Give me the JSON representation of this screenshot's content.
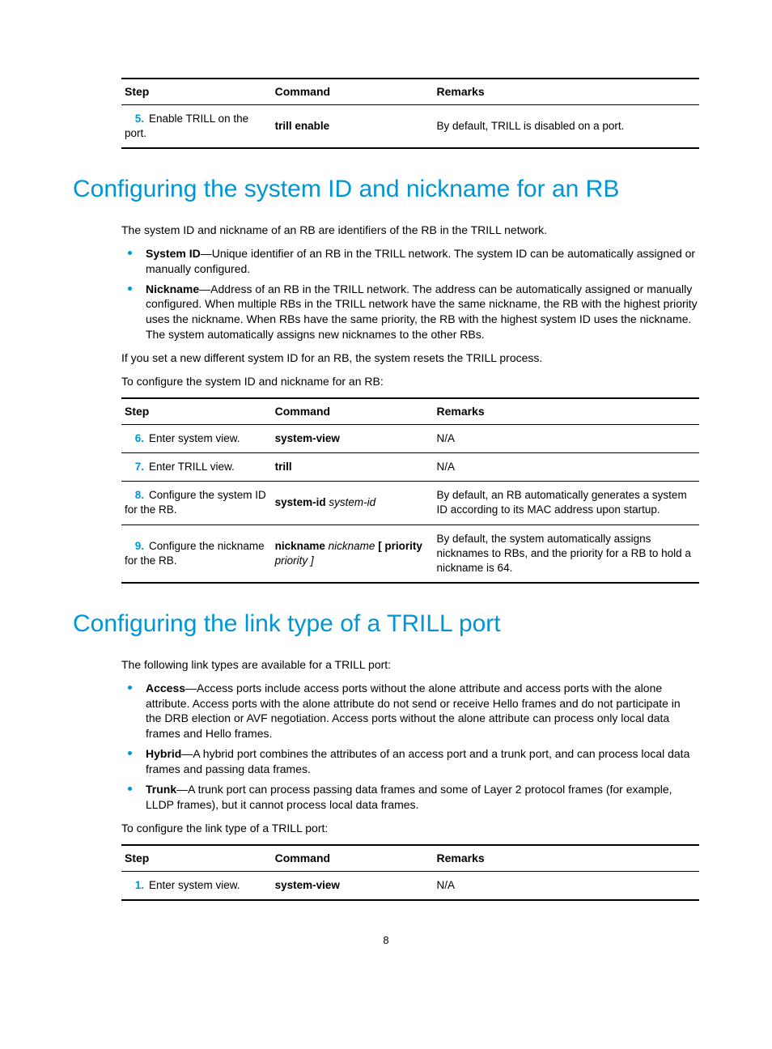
{
  "table1": {
    "headers": {
      "step": "Step",
      "command": "Command",
      "remarks": "Remarks"
    },
    "rows": [
      {
        "n": "5.",
        "step": "Enable TRILL on the port.",
        "cmd_bold": "trill enable",
        "cmd_italic": "",
        "remarks": "By default, TRILL is disabled on a port."
      }
    ]
  },
  "heading1": "Configuring the system ID and nickname for an RB",
  "h1_intro": "The system ID and nickname of an RB are identifiers of the RB in the TRILL network.",
  "h1_bullets": [
    {
      "term": "System ID",
      "text": "—Unique identifier of an RB in the TRILL network. The system ID can be automatically assigned or manually configured."
    },
    {
      "term": "Nickname",
      "text": "—Address of an RB in the TRILL network. The address can be automatically assigned or manually configured. When multiple RBs in the TRILL network have the same nickname, the RB with the highest priority uses the nickname. When RBs have the same priority, the RB with the highest system ID uses the nickname. The system automatically assigns new nicknames to the other RBs."
    }
  ],
  "h1_p2": "If you set a new different system ID for an RB, the system resets the TRILL process.",
  "h1_p3": "To configure the system ID and nickname for an RB:",
  "table2": {
    "headers": {
      "step": "Step",
      "command": "Command",
      "remarks": "Remarks"
    },
    "rows": [
      {
        "n": "6.",
        "step": "Enter system view.",
        "cmd_bold": "system-view",
        "cmd_italic": "",
        "cmd_bold2": "",
        "cmd_italic2": "",
        "remarks": "N/A"
      },
      {
        "n": "7.",
        "step": "Enter TRILL view.",
        "cmd_bold": "trill",
        "cmd_italic": "",
        "cmd_bold2": "",
        "cmd_italic2": "",
        "remarks": "N/A"
      },
      {
        "n": "8.",
        "step": "Configure the system ID for the RB.",
        "cmd_bold": "system-id",
        "cmd_italic": " system-id",
        "cmd_bold2": "",
        "cmd_italic2": "",
        "remarks": "By default, an RB automatically generates a system ID according to its MAC address upon startup."
      },
      {
        "n": "9.",
        "step": "Configure the nickname for the RB.",
        "cmd_bold": "nickname",
        "cmd_italic": " nickname ",
        "cmd_bold2": "[ priority",
        "cmd_italic2": " priority ]",
        "remarks": "By default, the system automatically assigns nicknames to RBs, and the priority for a RB to hold a nickname is 64."
      }
    ]
  },
  "heading2": "Configuring the link type of a TRILL port",
  "h2_intro": "The following link types are available for a TRILL port:",
  "h2_bullets": [
    {
      "term": "Access",
      "text": "—Access ports include access ports without the alone attribute and access ports with the alone attribute. Access ports with the alone attribute do not send or receive Hello frames and do not participate in the DRB election or AVF negotiation. Access ports without the alone attribute can process only local data frames and Hello frames."
    },
    {
      "term": "Hybrid",
      "text": "—A hybrid port combines the attributes of an access port and a trunk port, and can process local data frames and passing data frames."
    },
    {
      "term": "Trunk",
      "text": "—A trunk port can process passing data frames and some of Layer 2 protocol frames (for example, LLDP frames), but it cannot process local data frames."
    }
  ],
  "h2_p2": "To configure the link type of a TRILL port:",
  "table3": {
    "headers": {
      "step": "Step",
      "command": "Command",
      "remarks": "Remarks"
    },
    "rows": [
      {
        "n": "1.",
        "step": "Enter system view.",
        "cmd_bold": "system-view",
        "cmd_italic": "",
        "remarks": "N/A"
      }
    ]
  },
  "page_number": "8"
}
